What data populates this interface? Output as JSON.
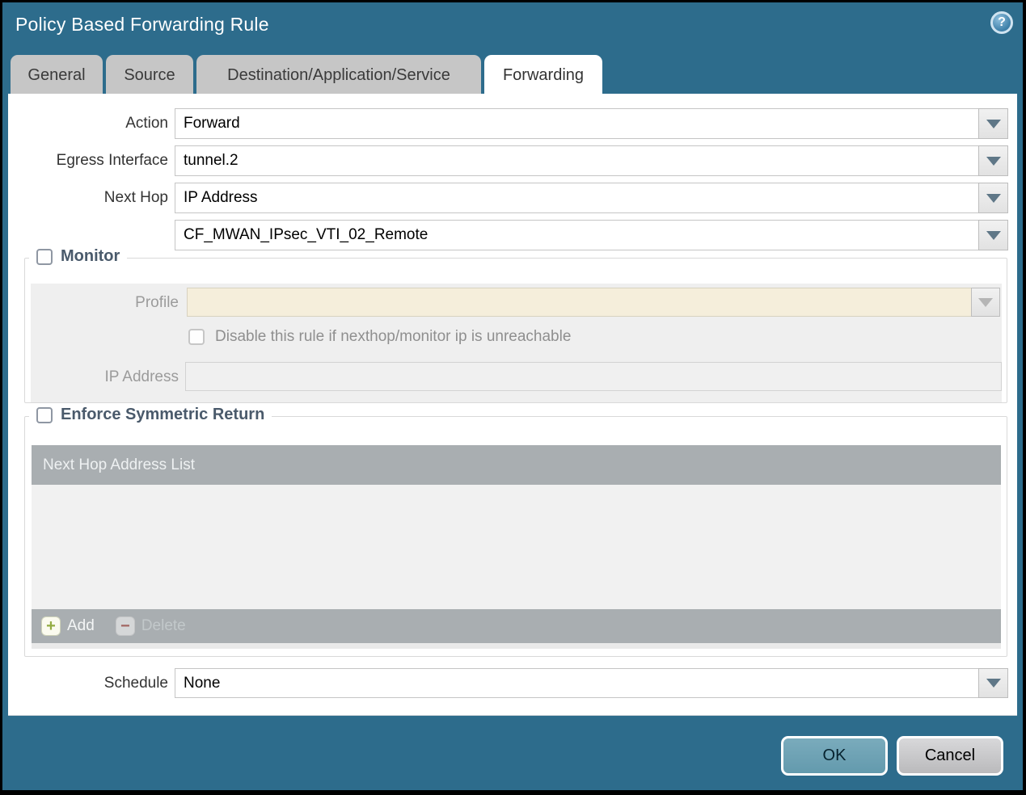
{
  "dialog": {
    "title": "Policy Based Forwarding Rule"
  },
  "icons": {
    "help": "?",
    "add": "+",
    "delete": "−"
  },
  "tabs": [
    {
      "label": "General",
      "active": false
    },
    {
      "label": "Source",
      "active": false
    },
    {
      "label": "Destination/Application/Service",
      "active": false
    },
    {
      "label": "Forwarding",
      "active": true
    }
  ],
  "form": {
    "action": {
      "label": "Action",
      "value": "Forward"
    },
    "egress_interface": {
      "label": "Egress Interface",
      "value": "tunnel.2"
    },
    "next_hop": {
      "label": "Next Hop",
      "value": "IP Address"
    },
    "next_hop_address": {
      "value": "CF_MWAN_IPsec_VTI_02_Remote"
    },
    "schedule": {
      "label": "Schedule",
      "value": "None"
    }
  },
  "monitor": {
    "label": "Monitor",
    "checked": false,
    "profile": {
      "label": "Profile",
      "value": ""
    },
    "disable_rule_checkbox": {
      "label": "Disable this rule if nexthop/monitor ip is unreachable",
      "checked": false
    },
    "ip_address": {
      "label": "IP Address",
      "value": ""
    }
  },
  "symmetric_return": {
    "label": "Enforce Symmetric Return",
    "checked": false,
    "table": {
      "header": "Next Hop Address List",
      "rows": []
    },
    "add_label": "Add",
    "delete_label": "Delete",
    "delete_enabled": false
  },
  "footer": {
    "ok_label": "OK",
    "cancel_label": "Cancel"
  },
  "colors": {
    "background": "#2d6c8c",
    "tab_inactive": "#c6c6c6",
    "ok_button": "#6ca2b4",
    "disabled_profile_field": "#f5eedb",
    "table_header": "#a9aeb1",
    "section_bg": "#efefef"
  }
}
